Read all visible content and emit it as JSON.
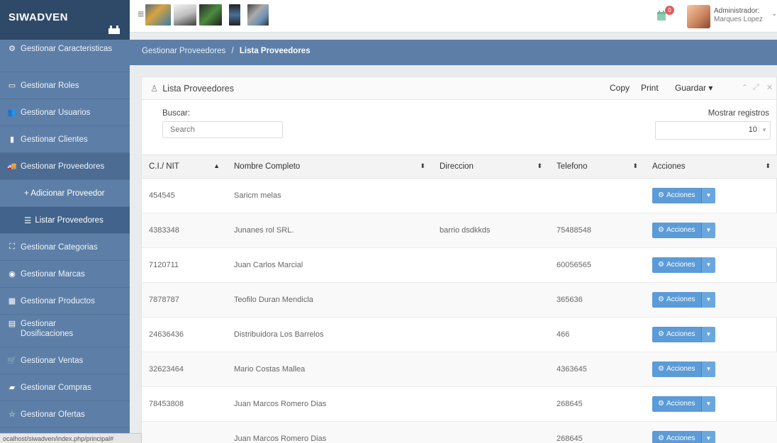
{
  "app": {
    "brand": "SIWADVEN"
  },
  "topbar": {
    "menu_icon": "hamburger-icon",
    "notification_count": "0",
    "user_role": "Administrador:",
    "user_name": "Marques Lopez"
  },
  "sidebar": {
    "items": [
      {
        "label": "Gestionar Caracteristicas",
        "icon": "cogs-icon"
      },
      {
        "label": "Gestionar Roles",
        "icon": "window-icon"
      },
      {
        "label": "Gestionar Usuarios",
        "icon": "users-icon"
      },
      {
        "label": "Gestionar Clientes",
        "icon": "clients-icon"
      },
      {
        "label": "Gestionar Proveedores",
        "icon": "truck-icon"
      },
      {
        "label": "+ Adicionar Proveedor",
        "icon": "plus-icon"
      },
      {
        "label": "Listar Proveedores",
        "icon": "list-icon"
      },
      {
        "label": "Gestionar Categorias",
        "icon": "sitemap-icon"
      },
      {
        "label": "Gestionar Marcas",
        "icon": "tag-icon"
      },
      {
        "label": "Gestionar Productos",
        "icon": "box-icon"
      },
      {
        "label": "Gestionar Dosificaciones",
        "icon": "document-icon"
      },
      {
        "label": "Gestionar Ventas",
        "icon": "cart-icon"
      },
      {
        "label": "Gestionar Compras",
        "icon": "credit-card-icon"
      },
      {
        "label": "Gestionar Ofertas",
        "icon": "star-icon"
      }
    ]
  },
  "status_bar": {
    "url": "ocalhost/siwadven/index.php/principal#"
  },
  "breadcrumb": {
    "parent": "Gestionar Proveedores",
    "separator": "/",
    "current": "Lista Proveedores"
  },
  "panel": {
    "title": "Lista Proveedores",
    "tools": {
      "copy": "Copy",
      "print": "Print",
      "save": "Guardar ▾"
    },
    "search": {
      "label": "Buscar:",
      "placeholder": "Search"
    },
    "records": {
      "label": "Mostrar registros",
      "value": "10"
    }
  },
  "table": {
    "columns": [
      "C.I./ NIT",
      "Nombre Completo",
      "Direccion",
      "Telefono",
      "Acciones"
    ],
    "action_label": "Acciones",
    "rows": [
      {
        "nit": "454545",
        "name": "Saricm melas",
        "address": "",
        "phone": ""
      },
      {
        "nit": "4383348",
        "name": "Junanes rol SRL.",
        "address": "barrio dsdkkds",
        "phone": "75488548"
      },
      {
        "nit": "7120711",
        "name": "Juan Carlos Marcial",
        "address": "",
        "phone": "60056565"
      },
      {
        "nit": "7878787",
        "name": "Teofilo Duran Mendicla",
        "address": "",
        "phone": "365636"
      },
      {
        "nit": "24636436",
        "name": "Distribuidora Los Barrelos",
        "address": "",
        "phone": "466"
      },
      {
        "nit": "32623464",
        "name": "Mario Costas Mallea",
        "address": "",
        "phone": "4363645"
      },
      {
        "nit": "78453808",
        "name": "Juan Marcos Romero Dias",
        "address": "",
        "phone": "268645"
      },
      {
        "nit": "",
        "name": "Juan Marcos Romero Dias",
        "address": "",
        "phone": "268645"
      }
    ]
  }
}
